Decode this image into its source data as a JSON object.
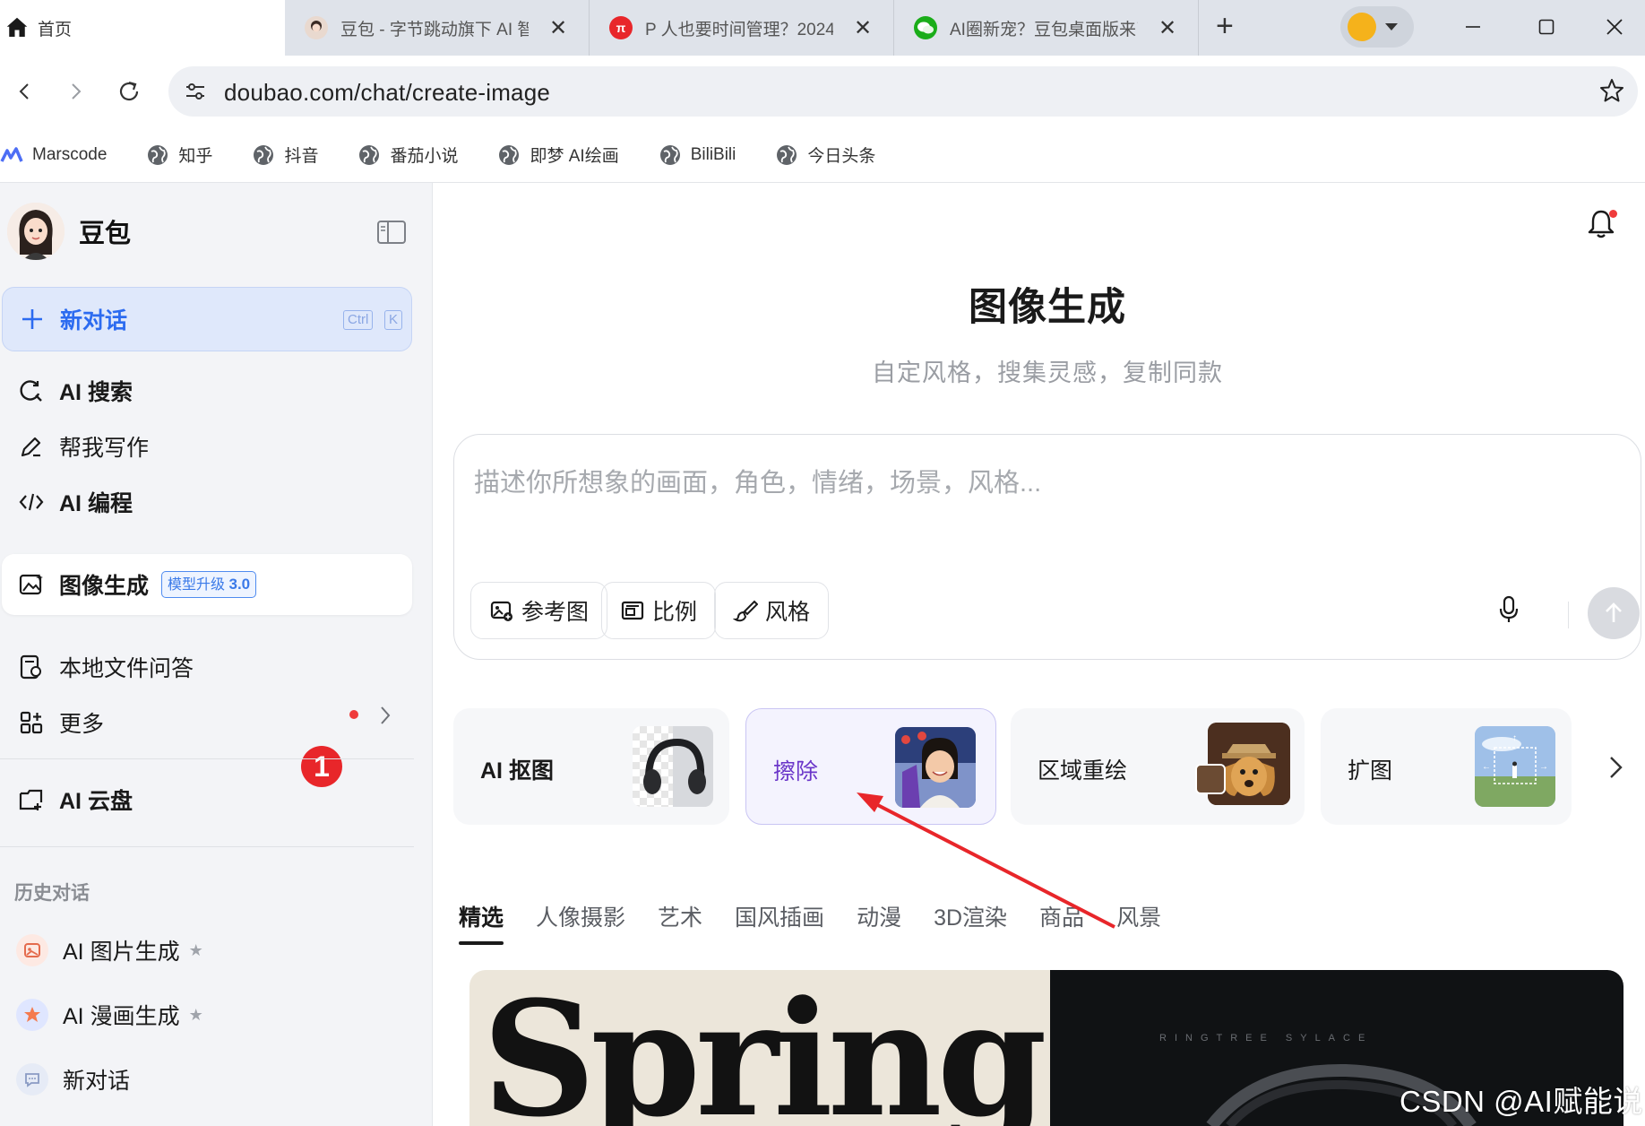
{
  "browser": {
    "home_tab": {
      "label": "首页"
    },
    "tabs": [
      {
        "title": "豆包 - 字节跳动旗下 AI 智能助手",
        "favicon": "doubao-avatar-icon",
        "color": "#e9d9cf"
      },
      {
        "title": "P 人也要时间管理？2024",
        "favicon": "zhihu-red-icon",
        "color": "#e8262a"
      },
      {
        "title": "AI圈新宠？豆包桌面版来了",
        "favicon": "wechat-icon",
        "color": "#1aad19"
      }
    ],
    "new_tab_label": "+",
    "address": "doubao.com/chat/create-image",
    "bookmarks": [
      {
        "label": "Marscode",
        "icon": "marscode-icon"
      },
      {
        "label": "知乎",
        "icon": "globe-icon"
      },
      {
        "label": "抖音",
        "icon": "globe-icon"
      },
      {
        "label": "番茄小说",
        "icon": "globe-icon"
      },
      {
        "label": "即梦 AI绘画",
        "icon": "globe-icon"
      },
      {
        "label": "BiliBili",
        "icon": "globe-icon"
      },
      {
        "label": "今日头条",
        "icon": "globe-icon"
      }
    ]
  },
  "sidebar": {
    "brand": "豆包",
    "new_chat": {
      "label": "新对话",
      "shortcut_1": "Ctrl",
      "shortcut_2": "K"
    },
    "items": [
      {
        "label": "AI 搜索",
        "icon": "search-refresh-icon"
      },
      {
        "label": "帮我写作",
        "icon": "pen-icon"
      },
      {
        "label": "AI 编程",
        "icon": "code-icon"
      },
      {
        "label": "图像生成",
        "icon": "image-gen-icon",
        "badge_text": "模型升级",
        "badge_version": "3.0",
        "active": true
      },
      {
        "label": "本地文件问答",
        "icon": "file-qa-icon"
      },
      {
        "label": "更多",
        "icon": "grid-icon"
      },
      {
        "label": "AI 云盘",
        "icon": "cloud-drive-icon"
      }
    ],
    "annotation_number": "1",
    "history_title": "历史对话",
    "history": [
      {
        "label": "AI 图片生成",
        "pinned": true
      },
      {
        "label": "AI 漫画生成",
        "pinned": true
      },
      {
        "label": "新对话",
        "pinned": false
      }
    ]
  },
  "main": {
    "title": "图像生成",
    "subtitle": "自定风格，搜集灵感，复制同款",
    "prompt_placeholder": "描述你所想象的画面，角色，情绪，场景，风格...",
    "chips": [
      {
        "label": "参考图",
        "icon": "ref-image-icon"
      },
      {
        "label": "比例",
        "icon": "ratio-icon"
      },
      {
        "label": "风格",
        "icon": "brush-icon"
      }
    ],
    "tools": [
      {
        "label": "AI 抠图",
        "thumb": "headphones-thumb"
      },
      {
        "label": "擦除",
        "thumb": "child-portrait-thumb",
        "highlighted": true
      },
      {
        "label": "区域重绘",
        "thumb": "dog-thumb"
      },
      {
        "label": "扩图",
        "thumb": "landscape-thumb"
      }
    ],
    "categories": [
      "精选",
      "人像摄影",
      "艺术",
      "国风插画",
      "动漫",
      "3D渲染",
      "商品",
      "风景"
    ],
    "gallery": {
      "left_text": "Spring",
      "right_caption": "RINGTREE  SYLACE"
    }
  },
  "watermark": "CSDN @AI赋能说",
  "colors": {
    "accent": "#2c6bf0",
    "annotation": "#e8262a",
    "highlight": "#6a35c9"
  }
}
